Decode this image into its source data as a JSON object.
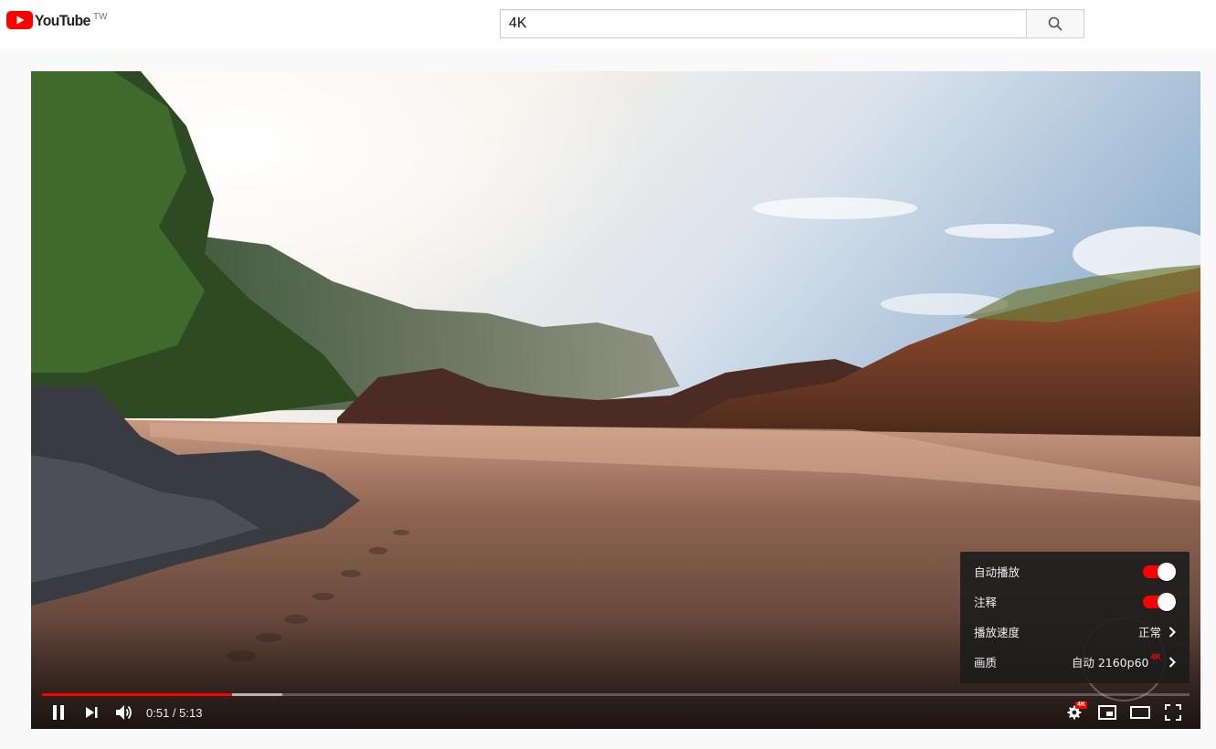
{
  "brand": {
    "name": "YouTube",
    "region": "TW",
    "color": "#ff0000"
  },
  "search": {
    "query": "4K",
    "button_icon": "search-icon"
  },
  "player": {
    "progress_fraction": 0.166,
    "buffered_fraction": 0.209,
    "accent_color": "#ff0000",
    "time_current": "0:51",
    "time_separator": " / ",
    "time_total": "5:13",
    "controls_left": [
      "pause-icon",
      "next-icon",
      "volume-icon"
    ],
    "controls_right": [
      "settings-icon",
      "miniplayer-icon",
      "theater-mode-icon",
      "fullscreen-icon"
    ],
    "settings_badge": "4K"
  },
  "settings_menu": {
    "autoplay": {
      "label": "自动播放",
      "enabled": true
    },
    "annotations": {
      "label": "注释",
      "enabled": true
    },
    "speed": {
      "label": "播放速度",
      "value": "正常"
    },
    "quality": {
      "label": "画质",
      "value": "自动 2160p60",
      "badge": "4K"
    }
  }
}
